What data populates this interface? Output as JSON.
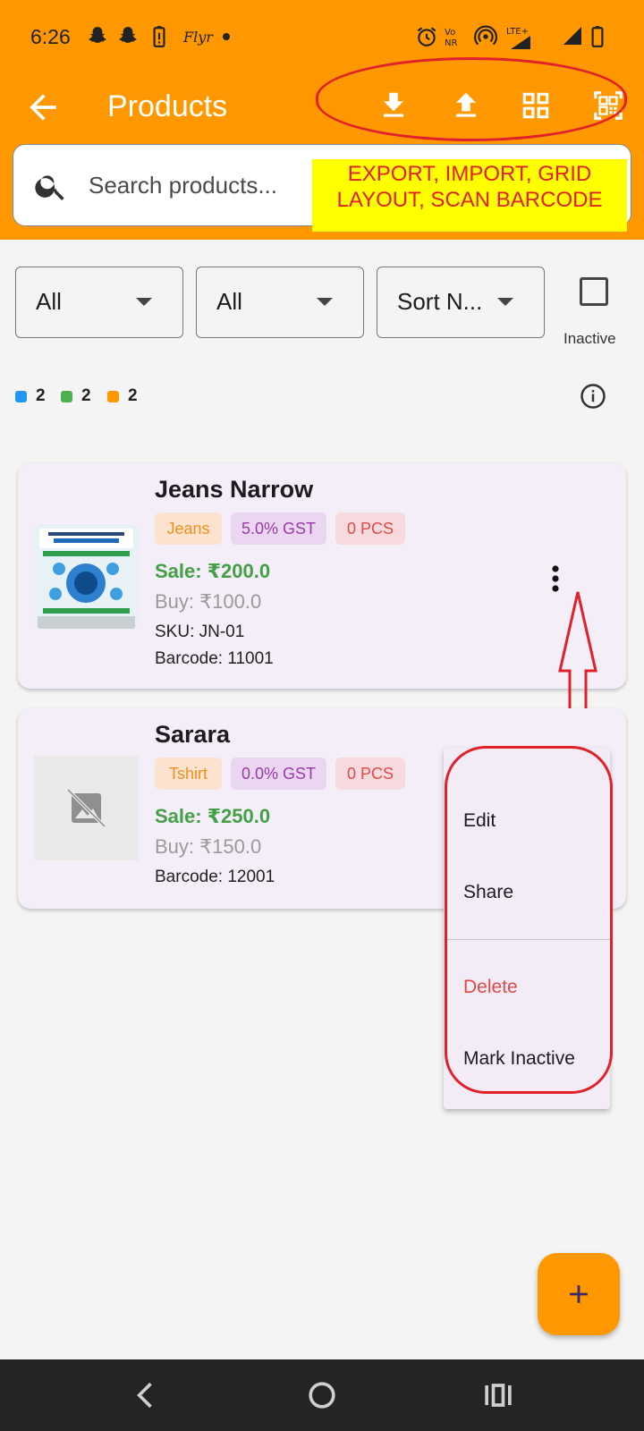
{
  "status_bar": {
    "time": "6:26",
    "carrier": "Flyr",
    "icons": [
      "snapchat-icon",
      "snapchat-icon",
      "battery-saver-icon",
      "alarm-icon",
      "volte-icon",
      "hotspot-icon",
      "lte-signal-icon",
      "signal-icon",
      "battery-icon"
    ]
  },
  "header": {
    "title": "Products",
    "actions": [
      "download-icon",
      "upload-icon",
      "grid-view-icon",
      "barcode-scan-icon"
    ]
  },
  "search": {
    "placeholder": "Search products..."
  },
  "annotation": {
    "toolbar_note": "EXPORT, IMPORT, GRID LAYOUT, SCAN BARCODE"
  },
  "filters": {
    "category": "All",
    "tax": "All",
    "sort": "Sort N...",
    "inactive_label": "Inactive"
  },
  "legend": [
    {
      "color": "#2196f3",
      "count": "2"
    },
    {
      "color": "#4caf50",
      "count": "2"
    },
    {
      "color": "#ff9800",
      "count": "2"
    }
  ],
  "products": [
    {
      "name": "Jeans Narrow",
      "category": "Jeans",
      "gst": "5.0% GST",
      "qty": "0 PCS",
      "sale": "Sale: ₹200.0",
      "buy": "Buy: ₹100.0",
      "sku": "SKU: JN-01",
      "barcode": "Barcode: 11001"
    },
    {
      "name": "Sarara",
      "category": "Tshirt",
      "gst": "0.0% GST",
      "qty": "0 PCS",
      "sale": "Sale: ₹250.0",
      "buy": "Buy: ₹150.0",
      "barcode": "Barcode: 12001"
    }
  ],
  "menu": {
    "edit": "Edit",
    "share": "Share",
    "delete": "Delete",
    "mark_inactive": "Mark Inactive"
  },
  "colors": {
    "primary": "#ff9800",
    "annotation_red": "#e0202a",
    "annotation_yellow": "#ffff00",
    "sale_green": "#43a047",
    "delete_red": "#e04a4a"
  }
}
